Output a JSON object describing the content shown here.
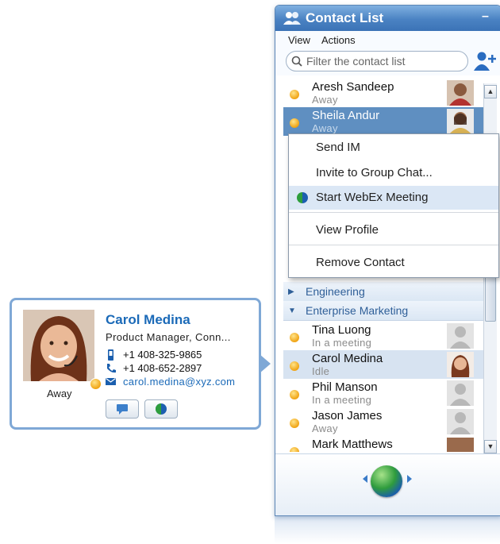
{
  "window": {
    "title": "Contact List",
    "minimize": "–",
    "menu": [
      "View",
      "Actions"
    ],
    "search_placeholder": "Filter the contact list"
  },
  "contacts_top": [
    {
      "name": "Aresh Sandeep",
      "status": "Away"
    },
    {
      "name": "Sheila Andur",
      "status": "Away"
    }
  ],
  "context_menu": {
    "items": [
      "Send IM",
      "Invite to Group Chat...",
      "Start WebEx Meeting",
      "View Profile",
      "Remove Contact"
    ]
  },
  "groups": [
    "Engineering",
    "Enterprise Marketing"
  ],
  "contacts_bottom": [
    {
      "name": "Tina Luong",
      "status": "In a meeting"
    },
    {
      "name": "Carol Medina",
      "status": "Idle"
    },
    {
      "name": "Phil Manson",
      "status": "In a meeting"
    },
    {
      "name": "Jason James",
      "status": "Away"
    },
    {
      "name": "Mark Matthews",
      "status": ""
    }
  ],
  "card": {
    "name": "Carol Medina",
    "title": "Product Manager, Conn...",
    "mobile": "+1 408-325-9865",
    "phone": "+1 408-652-2897",
    "email": "carol.medina@xyz.com",
    "status": "Away"
  },
  "colors": {
    "accent": "#1b6ab8",
    "selection": "#5f8fc1",
    "away": "#f0a313",
    "card_border": "#7fa8d6"
  },
  "icons": [
    "contacts-icon",
    "search-icon",
    "add-contact-icon",
    "webex-icon",
    "mobile-icon",
    "phone-icon",
    "email-icon",
    "chat-icon"
  ]
}
